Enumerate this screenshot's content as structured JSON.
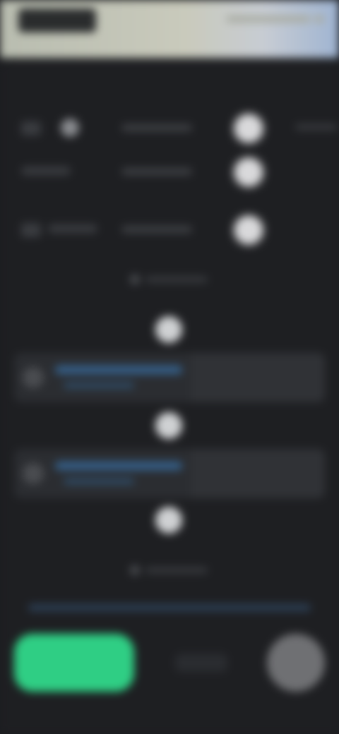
{
  "app": {
    "title": ""
  },
  "settings": [
    {
      "id": "row1",
      "label": "",
      "value": ""
    },
    {
      "id": "row2",
      "label": "",
      "value": ""
    },
    {
      "id": "row3",
      "label": "",
      "value": ""
    }
  ],
  "sections": {
    "first_caption": "",
    "second_caption": ""
  },
  "cards": [
    {
      "title": "",
      "subtitle": ""
    },
    {
      "title": "",
      "subtitle": ""
    }
  ],
  "footer": {
    "primary_button": "",
    "secondary_button": ""
  },
  "colors": {
    "accent_green": "#2fce84",
    "panel_bg": "#1e1f22",
    "link_blue": "#35618c"
  },
  "icons": [
    "logo-icon",
    "toggle-icon",
    "step-icon",
    "avatar-icon"
  ]
}
